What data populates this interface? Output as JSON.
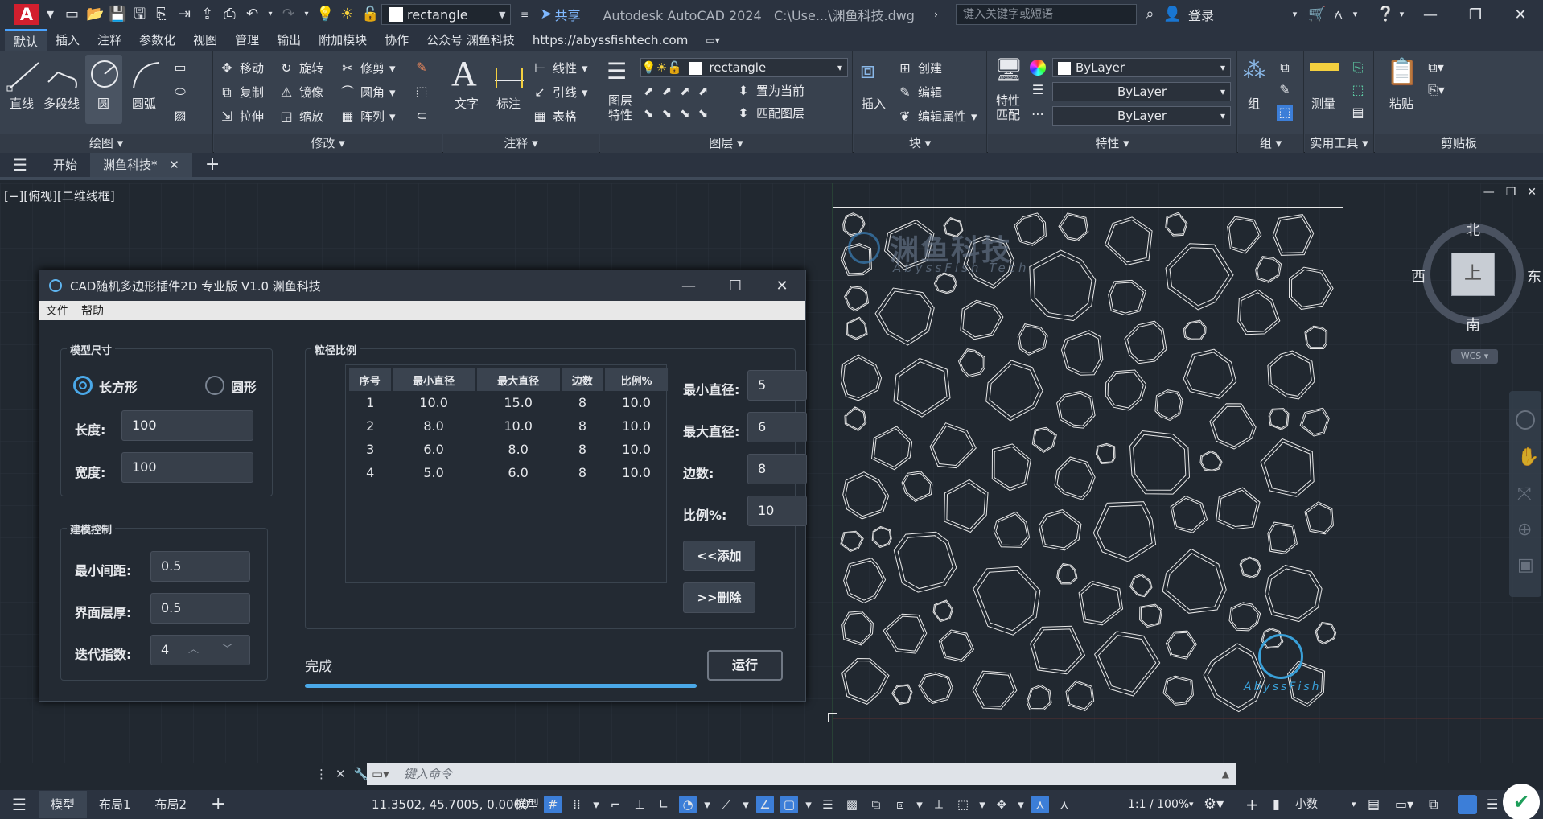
{
  "app": {
    "logo": "A",
    "title": "Autodesk AutoCAD 2024",
    "file_path": "C:\\Use...\\渊鱼科技.dwg",
    "layer_dropdown": "rectangle",
    "share": "共享",
    "search_placeholder": "键入关键字或短语",
    "login": "登录"
  },
  "menu_tabs": [
    "默认",
    "插入",
    "注释",
    "参数化",
    "视图",
    "管理",
    "输出",
    "附加模块",
    "协作",
    "公众号 渊鱼科技",
    "https://abyssfishtech.com"
  ],
  "ribbon": {
    "draw": {
      "title": "绘图",
      "line": "直线",
      "polyline": "多段线",
      "circle": "圆",
      "arc": "圆弧"
    },
    "modify": {
      "title": "修改",
      "move": "移动",
      "rotate": "旋转",
      "trim": "修剪",
      "copy": "复制",
      "mirror": "镜像",
      "fillet": "圆角",
      "stretch": "拉伸",
      "scale": "缩放",
      "array": "阵列"
    },
    "annotation": {
      "title": "注释",
      "text": "文字",
      "dimension": "标注",
      "linear": "线性",
      "leader": "引线",
      "table": "表格"
    },
    "layers": {
      "title": "图层",
      "props": "图层\n特性",
      "layer": "rectangle",
      "set_current": "置为当前",
      "match": "匹配图层"
    },
    "block": {
      "title": "块",
      "insert": "插入",
      "create": "创建",
      "edit": "编辑",
      "edit_attr": "编辑属性"
    },
    "properties": {
      "title": "特性",
      "match": "特性\n匹配",
      "color": "ByLayer",
      "linetype": "ByLayer",
      "lineweight": "ByLayer"
    },
    "groups": {
      "title": "组",
      "group": "组"
    },
    "utilities": {
      "title": "实用工具",
      "measure": "测量"
    },
    "clipboard": {
      "title": "剪贴板",
      "paste": "粘贴"
    }
  },
  "file_tabs": {
    "start": "开始",
    "current": "渊鱼科技*"
  },
  "viewport": {
    "label": "[−][俯视][二维线框]"
  },
  "compass": {
    "north": "北",
    "south": "南",
    "east": "东",
    "west": "西",
    "top": "上",
    "wcs": "WCS"
  },
  "watermark": {
    "cn": "渊鱼科技",
    "en": "AbyssFish Tech",
    "en2": "AbyssFish"
  },
  "command": {
    "placeholder": "键入命令"
  },
  "status": {
    "model_tab": "模型",
    "layout1": "布局1",
    "layout2": "布局2",
    "coords": "11.3502, 45.7005, 0.0000",
    "model": "模型",
    "scale": "1:1 / 100%",
    "units": "小数"
  },
  "dialog": {
    "title": "CAD随机多边形插件2D 专业版 V1.0 渊鱼科技",
    "menu": [
      "文件",
      "帮助"
    ],
    "size_group": "模型尺寸",
    "rect": "长方形",
    "circle": "圆形",
    "length_label": "长度:",
    "length": "100",
    "width_label": "宽度:",
    "width": "100",
    "ctrl_group": "建模控制",
    "min_gap_label": "最小间距:",
    "min_gap": "0.5",
    "layer_label": "界面层厚:",
    "layer": "0.5",
    "iter_label": "迭代指数:",
    "iter": "4",
    "grad_group": "粒径比例",
    "columns": [
      "序号",
      "最小直径",
      "最大直径",
      "边数",
      "比例%"
    ],
    "rows": [
      [
        "1",
        "10.0",
        "15.0",
        "8",
        "10.0"
      ],
      [
        "2",
        "8.0",
        "10.0",
        "8",
        "10.0"
      ],
      [
        "3",
        "6.0",
        "8.0",
        "8",
        "10.0"
      ],
      [
        "4",
        "5.0",
        "6.0",
        "8",
        "10.0"
      ]
    ],
    "min_d_label": "最小直径:",
    "min_d": "5",
    "max_d_label": "最大直径:",
    "max_d": "6",
    "sides_label": "边数:",
    "sides": "8",
    "ratio_label": "比例%:",
    "ratio": "10",
    "add": "<<添加",
    "del": ">>删除",
    "status": "完成",
    "run": "运行",
    "progress": 1.0
  },
  "colors": {
    "accent": "#4aa3ff",
    "bg": "#212830",
    "ribbon": "#38414e",
    "progress": "#4aa8e8"
  }
}
